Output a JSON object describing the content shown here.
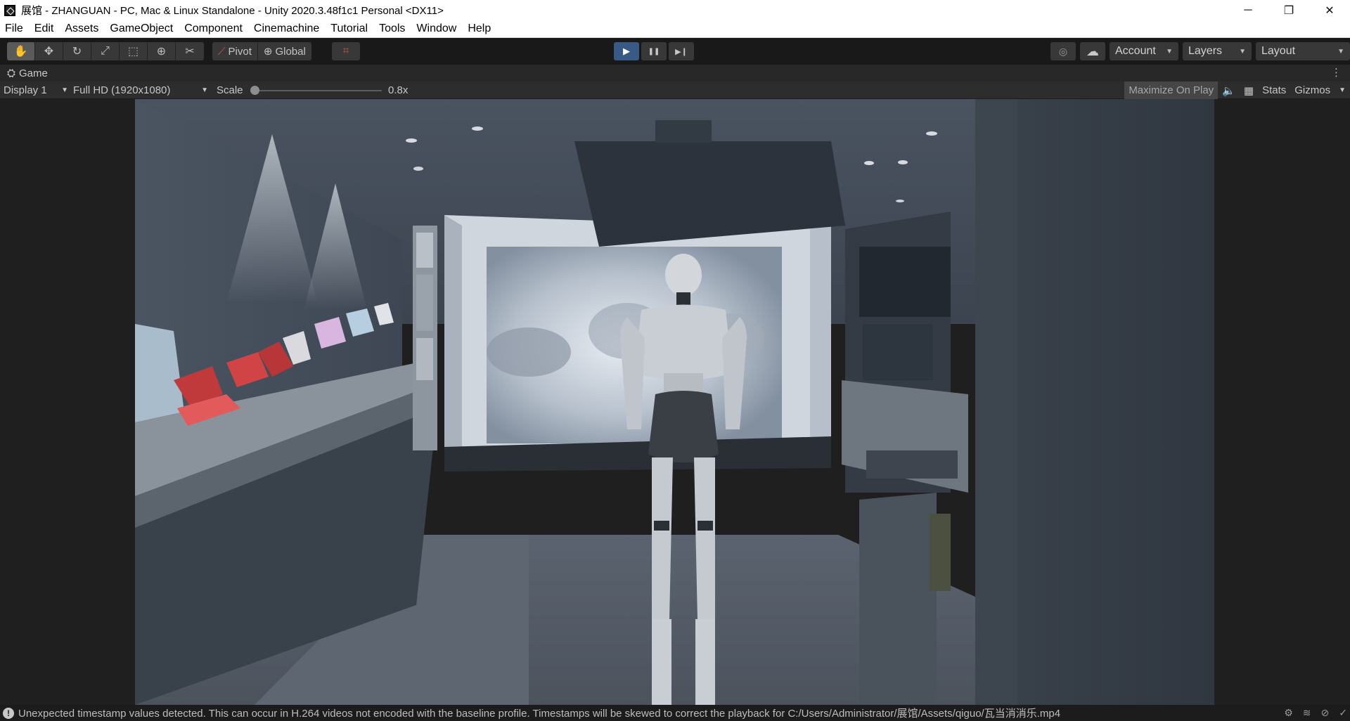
{
  "window": {
    "title": "展馆 - ZHANGUAN - PC, Mac & Linux Standalone - Unity 2020.3.48f1c1 Personal <DX11>",
    "controls": {
      "minimize": "─",
      "restore": "❐",
      "close": "✕"
    }
  },
  "menu": [
    "File",
    "Edit",
    "Assets",
    "GameObject",
    "Component",
    "Cinemachine",
    "Tutorial",
    "Tools",
    "Window",
    "Help"
  ],
  "toolbar": {
    "tools": [
      {
        "name": "hand-tool-icon",
        "glyph": "✋"
      },
      {
        "name": "move-tool-icon",
        "glyph": "✥"
      },
      {
        "name": "rotate-tool-icon",
        "glyph": "↻"
      },
      {
        "name": "scale-tool-icon",
        "glyph": "⤢"
      },
      {
        "name": "rect-tool-icon",
        "glyph": "⬚"
      },
      {
        "name": "transform-tool-icon",
        "glyph": "⊕"
      },
      {
        "name": "custom-tool-icon",
        "glyph": "✂"
      }
    ],
    "pivot_label": "Pivot",
    "global_label": "Global",
    "snap_glyph": "⌗",
    "play_glyph": "▶",
    "pause_glyph": "❚❚",
    "step_glyph": "▶❙",
    "collab_glyph": "◎",
    "cloud_glyph": "☁",
    "account_label": "Account",
    "layers_label": "Layers",
    "layout_label": "Layout",
    "caret": "▼"
  },
  "game_tab": {
    "icon": "⛭",
    "label": "Game",
    "menu_glyph": "⋮"
  },
  "game_bar": {
    "display": "Display 1",
    "resolution": "Full HD (1920x1080)",
    "scale_label": "Scale",
    "scale_value": "0.8x",
    "maximize_label": "Maximize On Play",
    "mute_glyph": "🔈",
    "stats_grid_glyph": "▦",
    "stats_label": "Stats",
    "gizmos_label": "Gizmos",
    "caret": "▼"
  },
  "status": {
    "icon": "!",
    "message": "Unexpected timestamp values detected. This can occur in H.264 videos not encoded with the baseline profile. Timestamps will be skewed to correct the playback for C:/Users/Administrator/展馆/Assets/qiguo/瓦当消消乐.mp4",
    "right_icons": [
      "⚙",
      "≋",
      "⊘",
      "✓"
    ]
  },
  "colors": {
    "accent_play": "#3a5a86",
    "panel": "#383838",
    "background": "#191919"
  }
}
